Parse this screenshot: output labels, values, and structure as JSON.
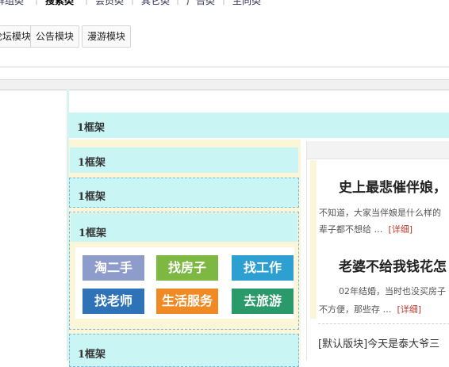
{
  "top_nav": {
    "items": [
      "群组类",
      "搜索类",
      "会员类",
      "其它类",
      "广告类",
      "主同类"
    ]
  },
  "modules": [
    "论坛模块",
    "公告模块",
    "漫游模块"
  ],
  "frames": {
    "label": "1框架"
  },
  "nav_buttons": [
    {
      "label": "淘二手",
      "color": "#8e9ccc"
    },
    {
      "label": "找房子",
      "color": "#7cb842"
    },
    {
      "label": "找工作",
      "color": "#2d9fd0"
    },
    {
      "label": "找老师",
      "color": "#2e72b8"
    },
    {
      "label": "生活服务",
      "color": "#f08a24"
    },
    {
      "label": "去旅游",
      "color": "#2a9a6a"
    }
  ],
  "news": [
    {
      "title": "史上最悲催伴娘，",
      "line1": "不知道，大家当伴娘是什么样的",
      "line2": "辈子都不想给 …",
      "more": "[详细]"
    },
    {
      "title": "老婆不给我钱花怎",
      "line1": "02年结婚，当时也没买房子",
      "line2": "不方便，那些存 …",
      "more": "[详细]"
    }
  ],
  "bottom_text": "[默认版块]今天是泰大爷三"
}
